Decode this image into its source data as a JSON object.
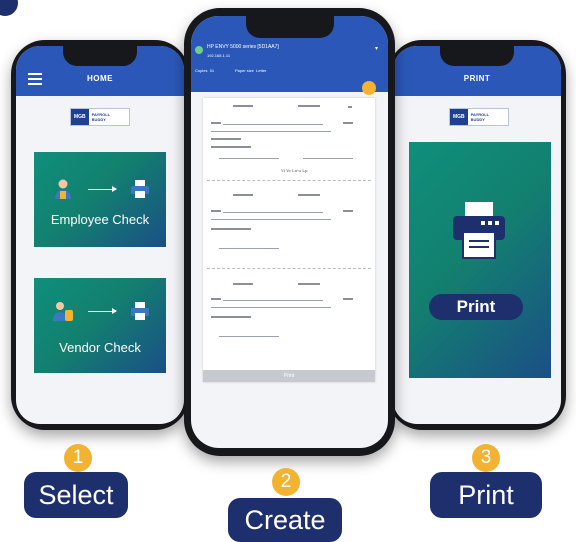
{
  "steps": [
    {
      "number": "1",
      "label": "Select"
    },
    {
      "number": "2",
      "label": "Create"
    },
    {
      "number": "3",
      "label": "Print"
    }
  ],
  "left_phone": {
    "title": "HOME",
    "logo": {
      "brand": "MGB",
      "line1": "PAYROLL",
      "line2": "BUDDY"
    },
    "cards": [
      {
        "label": "Employee Check",
        "from_icon": "employee-icon",
        "to_icon": "printer-icon"
      },
      {
        "label": "Vendor Check",
        "from_icon": "vendor-icon",
        "to_icon": "printer-icon"
      }
    ]
  },
  "middle_phone": {
    "printer_name": "HP ENVY 5000 series [5D1AA7]",
    "printer_ip": "192.168.1.11",
    "copies_label": "Copies",
    "copies_value": "01",
    "paper_size_label": "Paper size",
    "paper_size_value": "Letter",
    "signature": "Yi Ye Lu'u Lp",
    "bottom_button": "Print"
  },
  "right_phone": {
    "title": "PRINT",
    "logo": {
      "brand": "MGB",
      "line1": "PAYROLL",
      "line2": "BUDDY"
    },
    "print_button": "Print"
  },
  "colors": {
    "navy": "#1e2f6e",
    "blue": "#2b58b8",
    "badge": "#f2b232",
    "teal": "#0f8f7c"
  }
}
